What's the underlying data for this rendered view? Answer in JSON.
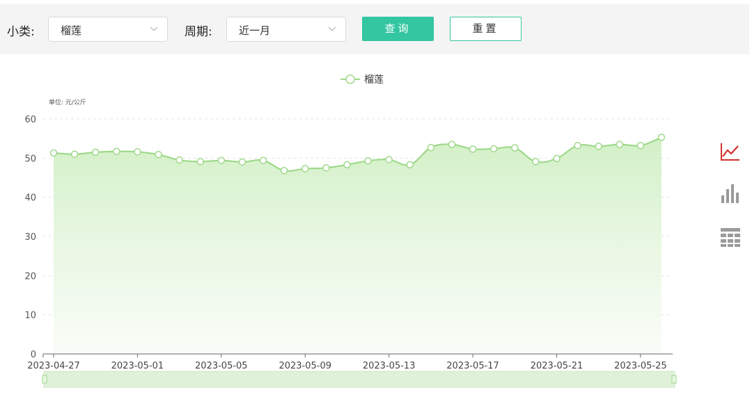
{
  "filters": {
    "category_label": "小类:",
    "category_value": "榴莲",
    "period_label": "周期:",
    "period_value": "近一月",
    "query_label": "查询",
    "reset_label": "重置"
  },
  "side_icons": [
    "line-chart-icon",
    "bar-chart-icon",
    "table-icon"
  ],
  "colors": {
    "accent": "#33c6a1",
    "line": "#9ed98a",
    "active_icon": "#d0302b",
    "inactive_icon": "#9a9a9a"
  },
  "chart_data": {
    "type": "area",
    "title": "",
    "unit_label": "单位: 元/公斤",
    "legend": "榴莲",
    "legend_position": "top-center",
    "grid": true,
    "ylim": [
      0,
      60
    ],
    "yticks": [
      "0",
      "10",
      "20",
      "30",
      "40",
      "50",
      "60"
    ],
    "xticks": [
      "2023-04-27",
      "2023-05-01",
      "2023-05-05",
      "2023-05-09",
      "2023-05-13",
      "2023-05-17",
      "2023-05-21",
      "2023-05-25"
    ],
    "x": [
      "2023-04-27",
      "2023-04-28",
      "2023-04-29",
      "2023-04-30",
      "2023-05-01",
      "2023-05-02",
      "2023-05-03",
      "2023-05-04",
      "2023-05-05",
      "2023-05-06",
      "2023-05-07",
      "2023-05-08",
      "2023-05-09",
      "2023-05-10",
      "2023-05-11",
      "2023-05-12",
      "2023-05-13",
      "2023-05-14",
      "2023-05-15",
      "2023-05-16",
      "2023-05-17",
      "2023-05-18",
      "2023-05-19",
      "2023-05-20",
      "2023-05-21",
      "2023-05-22",
      "2023-05-23",
      "2023-05-24",
      "2023-05-25",
      "2023-05-26"
    ],
    "series": [
      {
        "name": "榴莲",
        "values": [
          51.3,
          51.0,
          51.5,
          51.7,
          51.6,
          50.9,
          49.5,
          49.1,
          49.4,
          49.0,
          49.4,
          46.8,
          47.3,
          47.5,
          48.3,
          49.3,
          49.6,
          48.3,
          52.7,
          53.5,
          52.3,
          52.4,
          52.6,
          49.1,
          49.9,
          53.2,
          53.0,
          53.5,
          53.2,
          55.3
        ]
      }
    ]
  }
}
